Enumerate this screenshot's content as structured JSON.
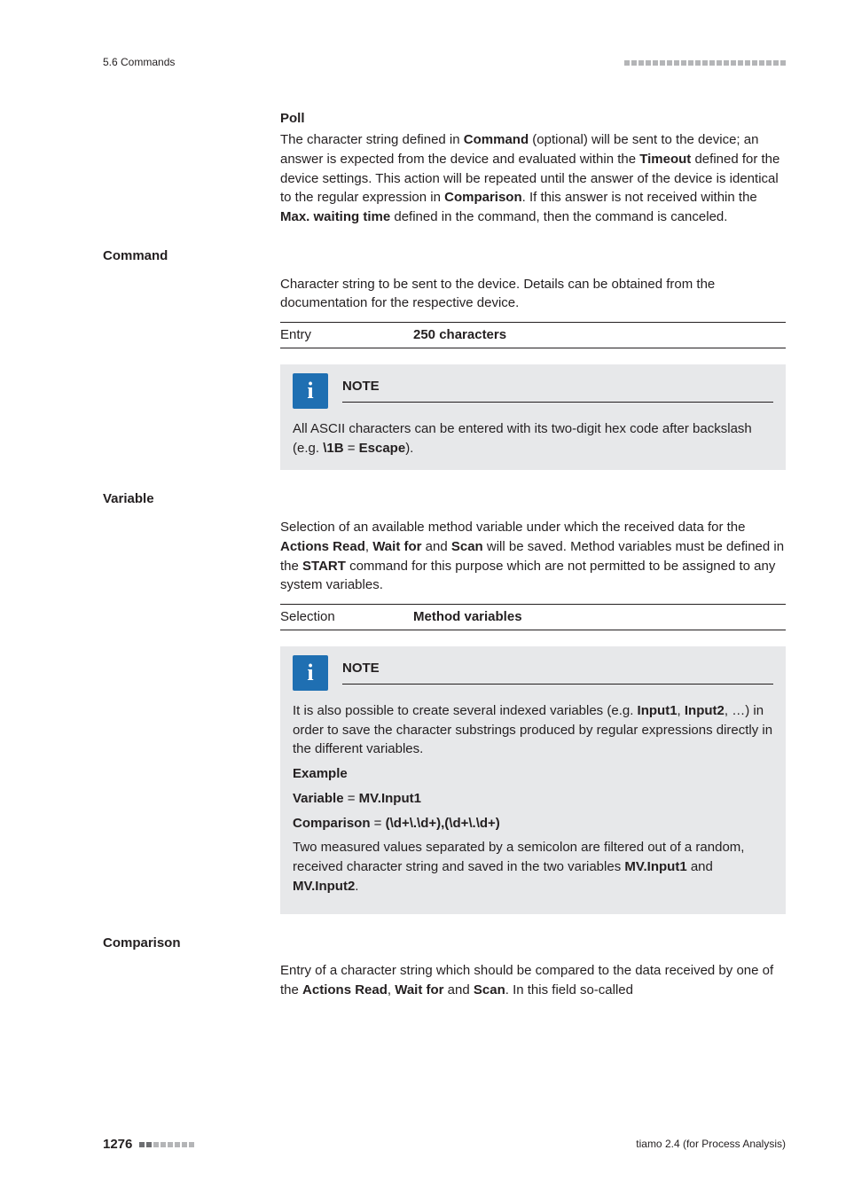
{
  "header": {
    "left": "5.6 Commands"
  },
  "poll": {
    "title": "Poll",
    "text_parts": [
      "The character string defined in ",
      "Command",
      " (optional) will be sent to the device; an answer is expected from the device and evaluated within the ",
      "Timeout",
      " defined for the device settings. This action will be repeated until the answer of the device is identical to the regular expression in ",
      "Comparison",
      ". If this answer is not received within the ",
      "Max. waiting time",
      " defined in the command, then the command is canceled."
    ]
  },
  "command": {
    "heading": "Command",
    "para": "Character string to be sent to the device. Details can be obtained from the documentation for the respective device.",
    "entry_label": "Entry",
    "entry_value": "250 characters",
    "note_title": "NOTE",
    "note_parts": [
      "All ASCII characters can be entered with its two-digit hex code after backslash (e.g. ",
      "\\1B",
      " = ",
      "Escape",
      ")."
    ]
  },
  "variable": {
    "heading": "Variable",
    "para_parts": [
      "Selection of an available method variable under which the received data for the ",
      "Actions Read",
      ", ",
      "Wait for",
      " and ",
      "Scan",
      " will be saved. Method variables must be defined in the ",
      "START",
      " command for this purpose which are not permitted to be assigned to any system variables."
    ],
    "sel_label": "Selection",
    "sel_value": "Method variables",
    "note_title": "NOTE",
    "note_parts": [
      "It is also possible to create several indexed variables (e.g. ",
      "Input1",
      ", ",
      "Input2",
      ", …) in order to save the character substrings produced by regular expressions directly in the different variables."
    ],
    "example_head": "Example",
    "example1_parts": [
      "Variable",
      " = ",
      "MV.Input1"
    ],
    "example2_parts": [
      "Comparison",
      " = ",
      "(\\d+\\.\\d+),(\\d+\\.\\d+)"
    ],
    "example3_parts": [
      "Two measured values separated by a semicolon are filtered out of a random, received character string and saved in the two variables ",
      "MV.Input1",
      " and ",
      "MV.Input2",
      "."
    ]
  },
  "comparison": {
    "heading": "Comparison",
    "para_parts": [
      "Entry of a character string which should be compared to the data received by one of the ",
      "Actions Read",
      ", ",
      "Wait for",
      " and ",
      "Scan",
      ". In this field so-called"
    ]
  },
  "footer": {
    "page": "1276",
    "right": "tiamo 2.4 (for Process Analysis)"
  }
}
